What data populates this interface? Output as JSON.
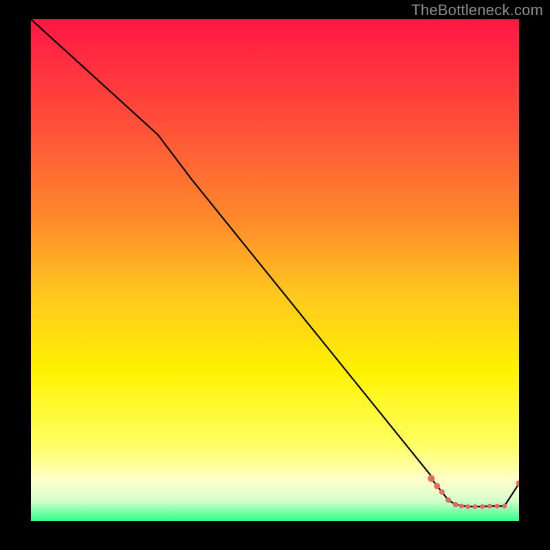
{
  "watermark": "TheBottleneck.com",
  "chart_data": {
    "type": "line",
    "title": "",
    "xlabel": "",
    "ylabel": "",
    "xlim": [
      0,
      100
    ],
    "ylim": [
      0,
      100
    ],
    "gradient_stops": [
      {
        "offset": 0.0,
        "color": "#ff1744"
      },
      {
        "offset": 0.2,
        "color": "#ff4d3a"
      },
      {
        "offset": 0.4,
        "color": "#ff8a2b"
      },
      {
        "offset": 0.55,
        "color": "#ffc81f"
      },
      {
        "offset": 0.7,
        "color": "#fff200"
      },
      {
        "offset": 0.85,
        "color": "#ffff66"
      },
      {
        "offset": 0.92,
        "color": "#ffffcc"
      },
      {
        "offset": 0.96,
        "color": "#d4ffcc"
      },
      {
        "offset": 1.0,
        "color": "#2eff87"
      }
    ],
    "series": [
      {
        "name": "bottleneck-curve",
        "points": [
          {
            "x": 0.0,
            "y": 100.0
          },
          {
            "x": 26.0,
            "y": 77.0
          },
          {
            "x": 33.0,
            "y": 68.0
          },
          {
            "x": 82.0,
            "y": 9.0
          },
          {
            "x": 82.0,
            "y": 8.5
          },
          {
            "x": 85.5,
            "y": 4.2
          },
          {
            "x": 87.0,
            "y": 3.3
          },
          {
            "x": 89.5,
            "y": 2.9
          },
          {
            "x": 92.0,
            "y": 2.9
          },
          {
            "x": 95.0,
            "y": 3.0
          },
          {
            "x": 97.0,
            "y": 3.0
          },
          {
            "x": 100.0,
            "y": 7.5
          }
        ]
      }
    ],
    "highlighted_points": [
      {
        "x": 82.0,
        "y": 8.5,
        "r": 5
      },
      {
        "x": 83.2,
        "y": 7.0,
        "r": 4.5
      },
      {
        "x": 84.2,
        "y": 5.8,
        "r": 4
      },
      {
        "x": 85.5,
        "y": 4.2,
        "r": 4
      },
      {
        "x": 87.0,
        "y": 3.3,
        "r": 4
      },
      {
        "x": 88.2,
        "y": 3.0,
        "r": 3.5
      },
      {
        "x": 89.5,
        "y": 2.9,
        "r": 3.5
      },
      {
        "x": 91.0,
        "y": 2.9,
        "r": 3.5
      },
      {
        "x": 92.5,
        "y": 2.9,
        "r": 3.5
      },
      {
        "x": 94.0,
        "y": 3.0,
        "r": 3.5
      },
      {
        "x": 95.5,
        "y": 3.0,
        "r": 3.5
      },
      {
        "x": 97.0,
        "y": 3.0,
        "r": 3.5
      },
      {
        "x": 100.0,
        "y": 7.5,
        "r": 4.5
      }
    ],
    "highlight_color": "#e86a5e"
  }
}
